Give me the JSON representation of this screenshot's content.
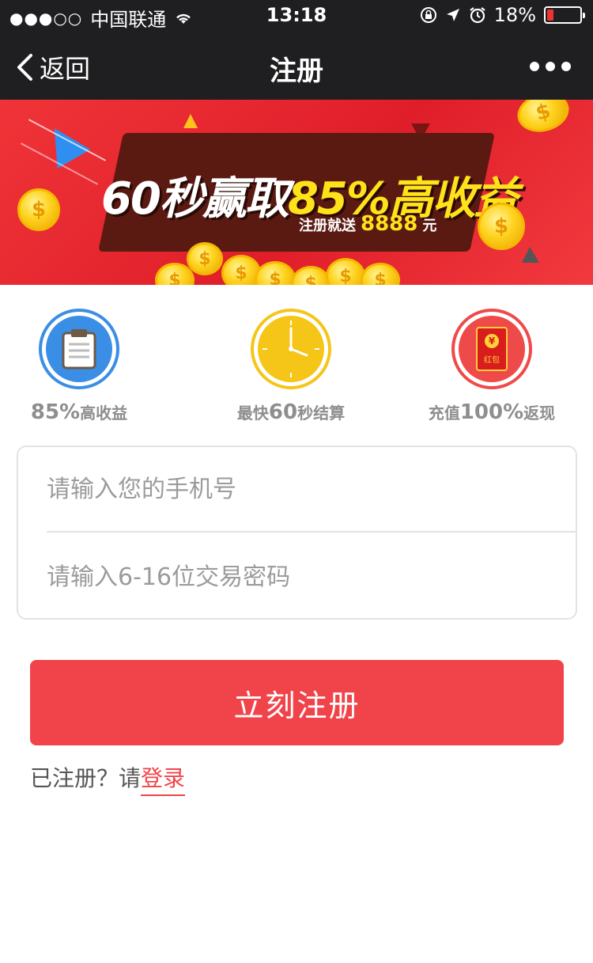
{
  "status_bar": {
    "signal": "●●●○○",
    "carrier": "中国联通",
    "time": "13:18",
    "battery": "18%",
    "battery_level": 0.18
  },
  "nav": {
    "back_label": "返回",
    "title": "注册"
  },
  "banner": {
    "headline_white": "60秒赢取",
    "headline_yellow": "85%高收益",
    "sub_prefix": "注册就送",
    "sub_amount": "8888",
    "sub_unit": "元",
    "coin_symbol": "$",
    "red_packet_text": "红包",
    "red_packet_symbol": "¥"
  },
  "features": [
    {
      "num": "85%",
      "text": "高收益",
      "color": "#3a8ee6"
    },
    {
      "num": "60",
      "prefix": "最快",
      "text": "秒结算",
      "color": "#f5c518"
    },
    {
      "num": "100%",
      "prefix": "充值",
      "text": "返现",
      "color": "#ef4a4a"
    }
  ],
  "form": {
    "phone_placeholder": "请输入您的手机号",
    "password_placeholder": "请输入6-16位交易密码"
  },
  "register_button": "立刻注册",
  "login_hint": {
    "prefix": "已注册？请",
    "link": "登录"
  },
  "colors": {
    "accent": "#f1444a",
    "nav_bg": "#1f1f21"
  }
}
